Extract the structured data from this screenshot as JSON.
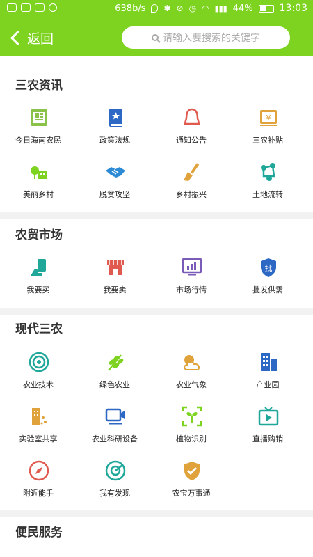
{
  "status": {
    "speed": "638b/s",
    "battery": "44%",
    "time": "13:03"
  },
  "header": {
    "back_label": "返回",
    "search_placeholder": "请输入要搜索的关键字"
  },
  "sections": [
    {
      "title": "三农资讯",
      "items": [
        {
          "label": "今日海南农民",
          "icon": "newspaper-icon"
        },
        {
          "label": "政策法规",
          "icon": "policy-book-icon"
        },
        {
          "label": "通知公告",
          "icon": "bell-icon"
        },
        {
          "label": "三农补贴",
          "icon": "subsidy-yen-icon"
        },
        {
          "label": "美丽乡村",
          "icon": "village-icon"
        },
        {
          "label": "脱贫攻坚",
          "icon": "handshake-icon"
        },
        {
          "label": "乡村振兴",
          "icon": "broom-icon"
        },
        {
          "label": "土地流转",
          "icon": "share-nodes-icon"
        }
      ]
    },
    {
      "title": "农贸市场",
      "items": [
        {
          "label": "我要买",
          "icon": "buy-hand-icon"
        },
        {
          "label": "我要卖",
          "icon": "shop-icon"
        },
        {
          "label": "市场行情",
          "icon": "chart-monitor-icon"
        },
        {
          "label": "批发供需",
          "icon": "wholesale-shield-icon",
          "glyph": "批"
        }
      ]
    },
    {
      "title": "现代三农",
      "items": [
        {
          "label": "农业技术",
          "icon": "tech-flower-icon"
        },
        {
          "label": "绿色农业",
          "icon": "leaf-icon"
        },
        {
          "label": "农业气象",
          "icon": "weather-icon"
        },
        {
          "label": "产业园",
          "icon": "buildings-icon"
        },
        {
          "label": "实验室共享",
          "icon": "lab-building-icon"
        },
        {
          "label": "农业科研设备",
          "icon": "research-camera-icon"
        },
        {
          "label": "植物识别",
          "icon": "plant-scan-icon"
        },
        {
          "label": "直播购销",
          "icon": "tv-play-icon"
        },
        {
          "label": "附近能手",
          "icon": "compass-icon"
        },
        {
          "label": "我有发现",
          "icon": "discover-icon"
        },
        {
          "label": "农宝万事通",
          "icon": "check-shield-icon"
        }
      ]
    },
    {
      "title": "便民服务",
      "items": []
    }
  ]
}
